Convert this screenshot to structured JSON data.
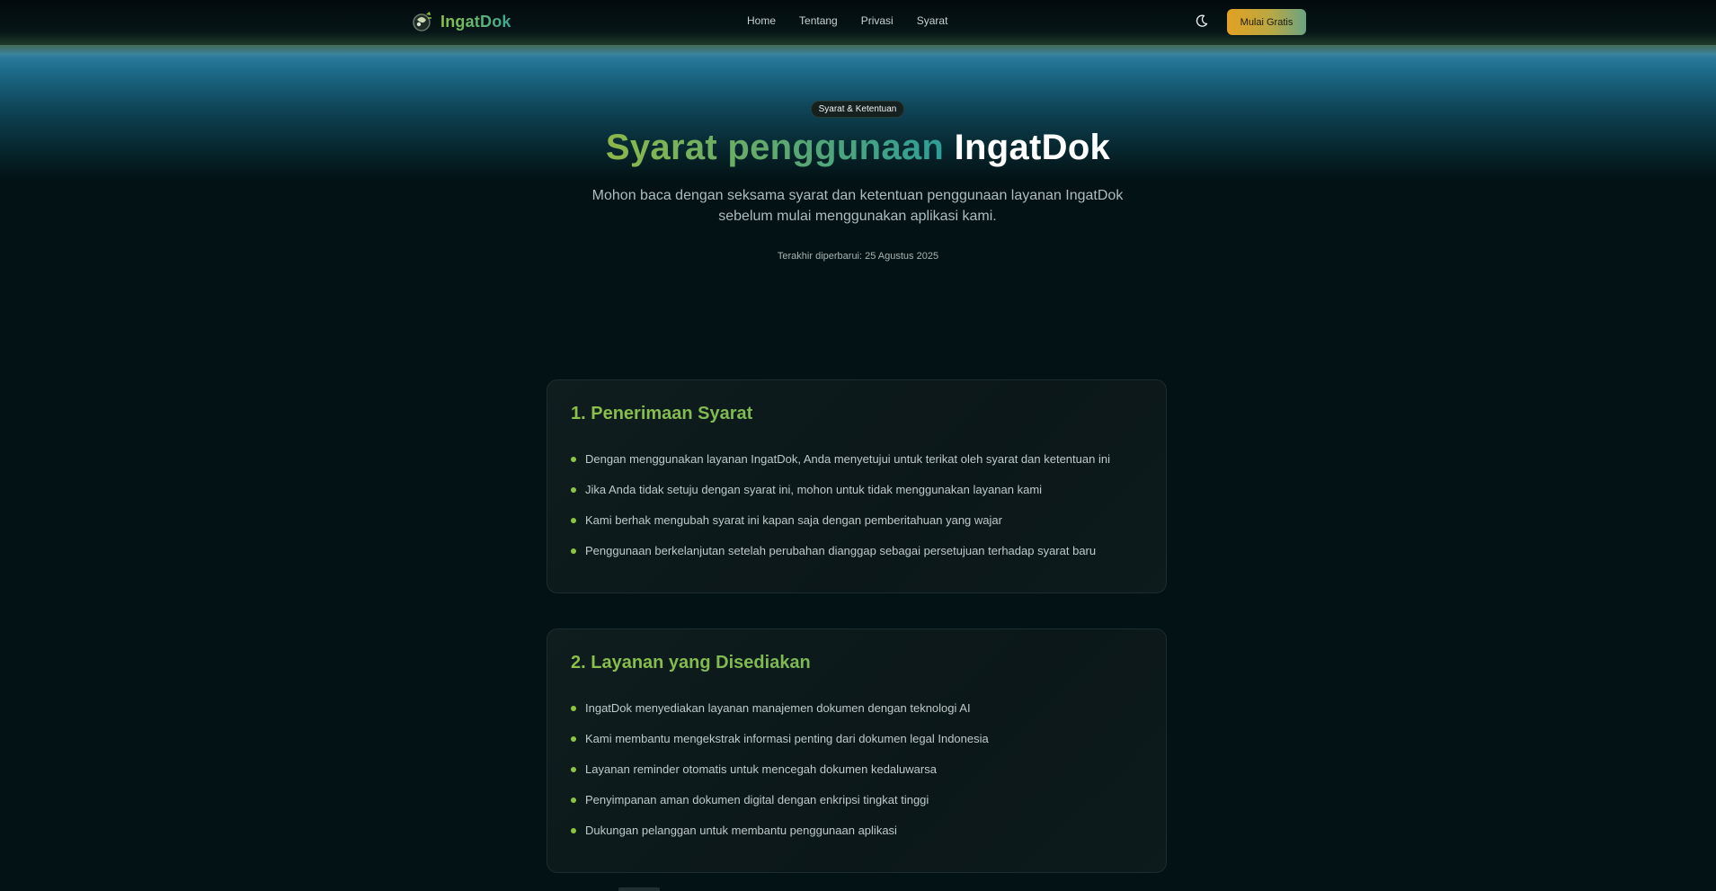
{
  "navbar": {
    "brand": "IngatDok",
    "links": [
      "Home",
      "Tentang",
      "Privasi",
      "Syarat"
    ],
    "cta_label": "Mulai Gratis",
    "theme_icon": "moon-icon"
  },
  "hero": {
    "badge": "Syarat & Ketentuan",
    "title_accent": "Syarat penggunaan",
    "title_plain": "IngatDok",
    "subtitle": "Mohon baca dengan seksama syarat dan ketentuan penggunaan layanan IngatDok sebelum mulai menggunakan aplikasi kami.",
    "updated": "Terakhir diperbarui: 25 Agustus 2025"
  },
  "sections": [
    {
      "title": "1. Penerimaan Syarat",
      "items": [
        "Dengan menggunakan layanan IngatDok, Anda menyetujui untuk terikat oleh syarat dan ketentuan ini",
        "Jika Anda tidak setuju dengan syarat ini, mohon untuk tidak menggunakan layanan kami",
        "Kami berhak mengubah syarat ini kapan saja dengan pemberitahuan yang wajar",
        "Penggunaan berkelanjutan setelah perubahan dianggap sebagai persetujuan terhadap syarat baru"
      ]
    },
    {
      "title": "2. Layanan yang Disediakan",
      "items": [
        "IngatDok menyediakan layanan manajemen dokumen dengan teknologi AI",
        "Kami membantu mengekstrak informasi penting dari dokumen legal Indonesia",
        "Layanan reminder otomatis untuk mencegah dokumen kedaluwarsa",
        "Penyimpanan aman dokumen digital dengan enkripsi tingkat tinggi",
        "Dukungan pelanggan untuk membantu penggunaan aplikasi"
      ]
    }
  ],
  "colors": {
    "background": "#031214",
    "accent_green": "#8cc63f",
    "accent_teal": "#2f9d96",
    "cta_orange": "#e3a122"
  }
}
